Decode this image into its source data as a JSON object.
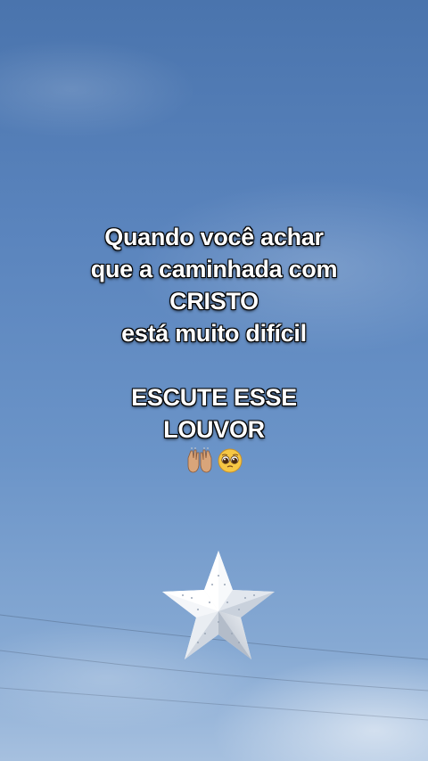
{
  "overlay": {
    "lines": [
      "Quando você achar",
      "que a caminhada com",
      "CRISTO",
      "está muito difícil",
      "ESCUTE ESSE",
      "LOUVOR"
    ],
    "emojis": [
      "raising-hands-emoji",
      "pleading-face-emoji"
    ]
  },
  "colors": {
    "sky_top": "#4a74ad",
    "sky_bottom": "#a6c0df",
    "text": "#ffffff"
  }
}
